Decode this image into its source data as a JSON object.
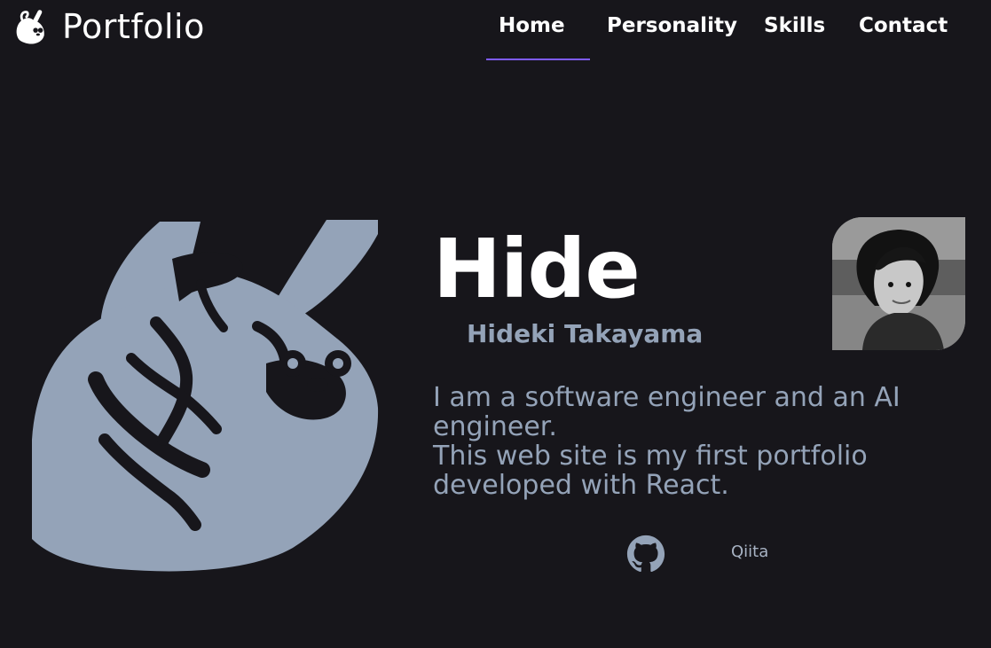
{
  "brand": {
    "title": "Portfolio",
    "icon": "sloth-icon"
  },
  "nav": {
    "items": [
      {
        "label": "Home",
        "active": true
      },
      {
        "label": "Personality",
        "active": false
      },
      {
        "label": "Skills",
        "active": false
      },
      {
        "label": "Contact",
        "active": false
      }
    ],
    "active_color": "#7e5bff"
  },
  "hero": {
    "name": "Hide",
    "full_name": "Hideki Takayama",
    "bio_lines": [
      "I am a software engineer and an AI",
      "engineer.",
      "This web site is my first portfolio",
      "developed with React."
    ],
    "illustration": "sloth-illustration",
    "profile_photo": "profile-photo"
  },
  "social": {
    "github_icon": "github-icon",
    "qiita_label": "Qiita"
  },
  "colors": {
    "background": "#17161b",
    "accent": "#7e5bff",
    "muted_text": "#94a3b8",
    "headline": "#ffffff"
  }
}
